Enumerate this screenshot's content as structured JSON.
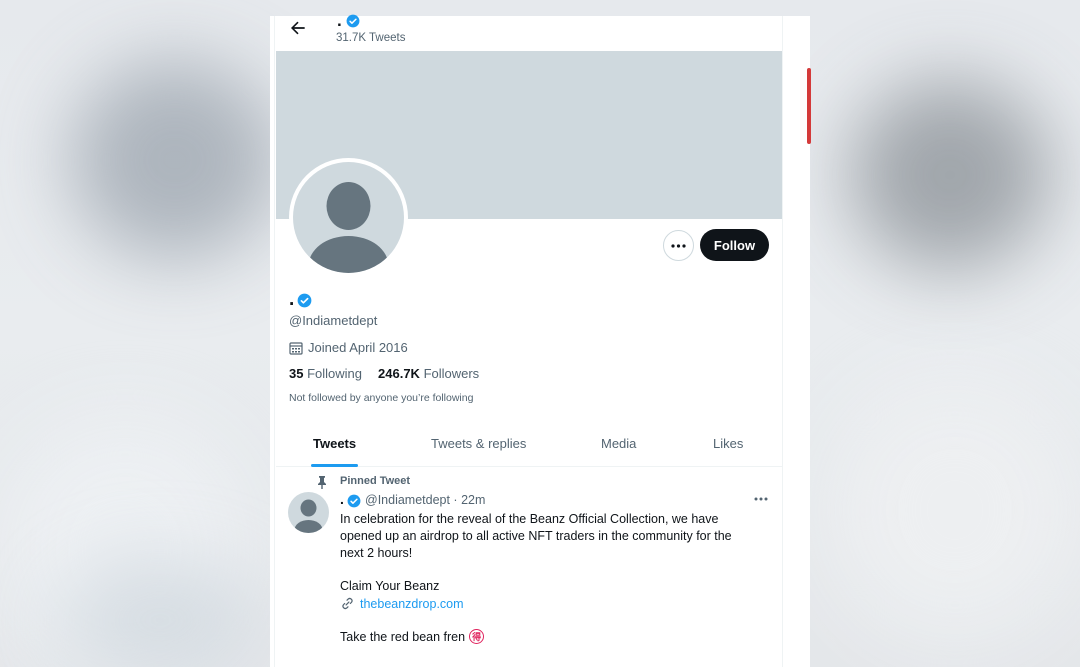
{
  "header": {
    "display_name": ".",
    "tweet_count": "31.7K Tweets"
  },
  "profile": {
    "display_name": ".",
    "handle": "@Indiametdept",
    "joined": "Joined April 2016",
    "following_count": "35",
    "following_label": "Following",
    "followers_count": "246.7K",
    "followers_label": "Followers",
    "not_followed_text": "Not followed by anyone you’re following",
    "follow_label": "Follow"
  },
  "tabs": [
    {
      "label": "Tweets",
      "active": true
    },
    {
      "label": "Tweets & replies",
      "active": false
    },
    {
      "label": "Media",
      "active": false
    },
    {
      "label": "Likes",
      "active": false
    }
  ],
  "tweet": {
    "pinned_label": "Pinned Tweet",
    "display_name": ".",
    "meta": "@Indiametdept · 22m",
    "body": "In celebration for the reveal of the Beanz Official Collection, we have opened up an airdrop to all active NFT traders in the community for the next 2 hours!",
    "claim_text": "Claim Your Beanz",
    "link_text": "thebeanzdrop.com",
    "red_bean_text": "Take the red bean fren",
    "red_bean_glyph": "得"
  },
  "colors": {
    "accent": "#1d9bf0",
    "text_primary": "#0f1419",
    "text_secondary": "#536471",
    "banner": "#cfd9de"
  },
  "icons": [
    "back-arrow-icon",
    "verified-badge-icon",
    "more-icon",
    "calendar-icon",
    "pin-icon",
    "link-icon",
    "default-avatar-icon"
  ]
}
